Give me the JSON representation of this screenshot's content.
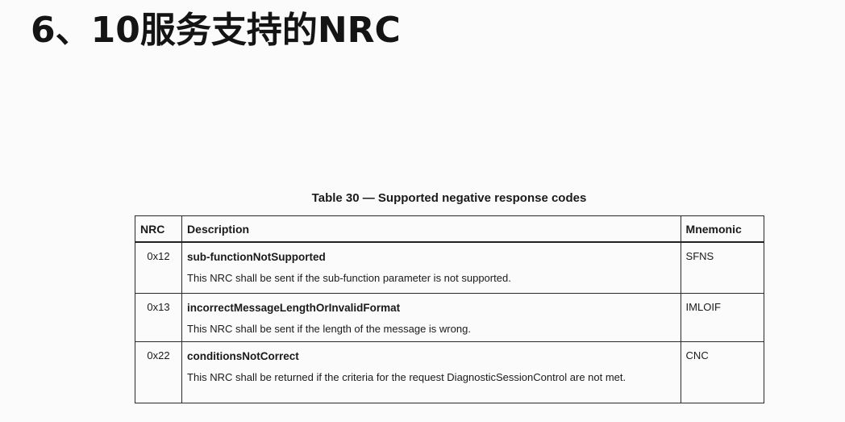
{
  "slide": {
    "title": "6、10服务支持的NRC"
  },
  "table": {
    "caption": "Table 30 — Supported negative response codes",
    "headers": {
      "nrc": "NRC",
      "description": "Description",
      "mnemonic": "Mnemonic"
    },
    "rows": [
      {
        "code": "0x12",
        "name": "sub-functionNotSupported",
        "text": "This NRC shall be sent if the sub-function parameter is not supported.",
        "mnemonic": "SFNS"
      },
      {
        "code": "0x13",
        "name": "incorrectMessageLengthOrInvalidFormat",
        "text": "This NRC shall be sent if the length of the message is wrong.",
        "mnemonic": "IMLOIF"
      },
      {
        "code": "0x22",
        "name": "conditionsNotCorrect",
        "text": "This NRC shall be returned if the criteria for the request DiagnosticSessionControl are not met.",
        "mnemonic": "CNC"
      }
    ]
  }
}
